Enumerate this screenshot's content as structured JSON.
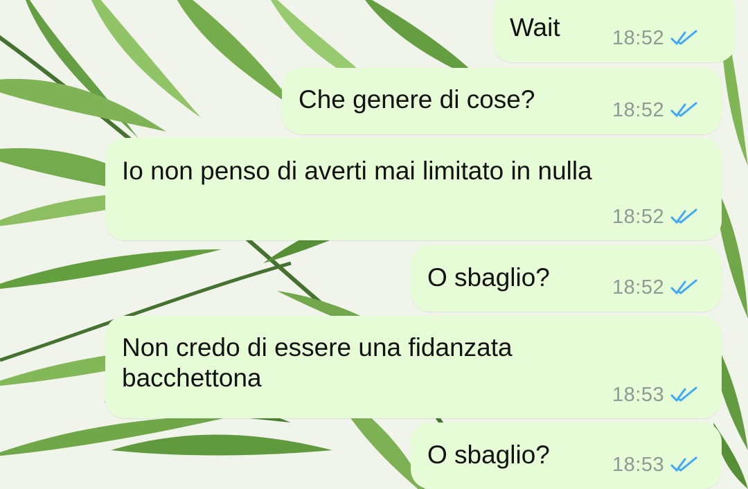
{
  "chat": {
    "messages": [
      {
        "text": "Wait",
        "time": "18:52",
        "status": "read"
      },
      {
        "text": "Che genere di cose?",
        "time": "18:52",
        "status": "read"
      },
      {
        "text": "Io non penso di averti mai limitato in nulla",
        "time": "18:52",
        "status": "read"
      },
      {
        "text": "O sbaglio?",
        "time": "18:52",
        "status": "read"
      },
      {
        "text": "Non credo di essere una fidanzata\nbacchettona",
        "time": "18:53",
        "status": "read"
      },
      {
        "text": "O sbaglio?",
        "time": "18:53",
        "status": "read"
      }
    ]
  },
  "colors": {
    "bubble_outgoing": "#e6fcd6",
    "read_ticks": "#3fa9f5",
    "time_text": "#8d9a93",
    "message_text": "#121212"
  },
  "icons": {
    "status": "double-check-icon",
    "wallpaper": "palm-leaf-wallpaper"
  }
}
